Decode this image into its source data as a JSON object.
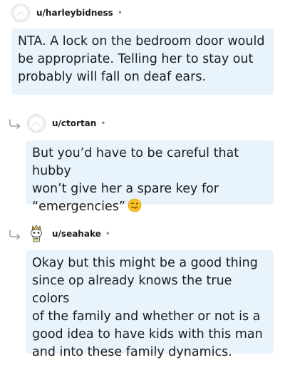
{
  "comments": [
    {
      "username": "u/harleybidness",
      "dot": "•",
      "avatar_icon": "default-avatar-icon",
      "text": "NTA. A lock on the bedroom door would\nbe appropriate. Telling her to stay out\nprobably will fall on deaf ears."
    },
    {
      "username": "u/ctortan",
      "dot": "•",
      "avatar_icon": "default-avatar-icon",
      "reply_icon": "reply-arrow-icon",
      "text": "But you’d have to be careful that hubby\nwon’t give her a spare key for\n“emergencies”",
      "emoji": "winking-face-with-tongue-emoji"
    },
    {
      "username": "u/seahake",
      "dot": "•",
      "avatar_icon": "snoo-avatar-icon",
      "reply_icon": "reply-arrow-icon",
      "text": "Okay but this might be a good thing\nsince op already knows the true colors\nof the family and whether or not is a\ngood idea to have kids with this man\nand into these family dynamics."
    }
  ],
  "colors": {
    "bubble_background": "#e9f3fb",
    "text": "#1c1c1c",
    "meta": "#878a8c",
    "avatar_border": "#d6dadc"
  }
}
